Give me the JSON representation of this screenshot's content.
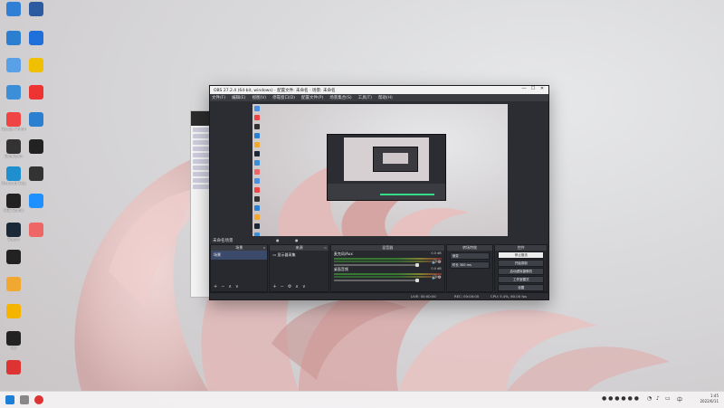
{
  "desktop": {
    "icons_left": [
      {
        "label": "",
        "icon": "monitor-icon",
        "color": "#2f7fd7"
      },
      {
        "label": "",
        "icon": "network-icon",
        "color": "#2b7fd0"
      },
      {
        "label": "",
        "icon": "control-panel-icon",
        "color": "#5aa0e6"
      },
      {
        "label": "",
        "icon": "computer-icon",
        "color": "#3a8fd8"
      },
      {
        "label": "Google Chrome",
        "icon": "chrome-icon",
        "color": "#e44"
      },
      {
        "label": "Bandicam",
        "icon": "camera-icon",
        "color": "#333"
      },
      {
        "label": "Microsoft Edge",
        "icon": "edge-icon",
        "color": "#1f8fd0"
      },
      {
        "label": "OBS Studio",
        "icon": "obs-icon",
        "color": "#222"
      },
      {
        "label": "Steam",
        "icon": "steam-icon",
        "color": "#1b2838"
      },
      {
        "label": "",
        "icon": "app-icon",
        "color": "#222"
      },
      {
        "label": "",
        "icon": "folder-icon",
        "color": "#f0a830"
      },
      {
        "label": "",
        "icon": "app-icon",
        "color": "#f5b400"
      },
      {
        "label": "QQ",
        "icon": "qq-icon",
        "color": "#222"
      },
      {
        "label": "",
        "icon": "music-icon",
        "color": "#d33"
      }
    ],
    "icons_right": [
      {
        "label": "",
        "icon": "app-icon",
        "color": "#2c5aa0"
      },
      {
        "label": "",
        "icon": "globe-icon",
        "color": "#1e6fd9"
      },
      {
        "label": "",
        "icon": "game-icon",
        "color": "#f0c000"
      },
      {
        "label": "",
        "icon": "app-icon",
        "color": "#e33"
      },
      {
        "label": "",
        "icon": "bird-icon",
        "color": "#2b7fd0"
      },
      {
        "label": "",
        "icon": "app-icon",
        "color": "#222"
      },
      {
        "label": "",
        "icon": "app-icon",
        "color": "#333"
      },
      {
        "label": "",
        "icon": "app-icon",
        "color": "#1e90ff"
      },
      {
        "label": "",
        "icon": "app-icon",
        "color": "#e66"
      }
    ]
  },
  "obs": {
    "title": "OBS 27.2.4 (64-bit, windows) - 配置文件: 未命名 - 场景: 未命名",
    "menu": [
      "文件(F)",
      "编辑(E)",
      "视图(V)",
      "停靠窗口(D)",
      "配置文件(P)",
      "场景集合(S)",
      "工具(T)",
      "帮助(H)"
    ],
    "scene_bar_label": "未命名场景",
    "toggle_a": "●",
    "toggle_b": "●",
    "docks": {
      "scenes": {
        "header": "场景",
        "items": [
          "场景"
        ]
      },
      "sources": {
        "header": "来源",
        "items": [
          "显示器采集"
        ]
      },
      "mixer": {
        "header": "混音器",
        "tracks": [
          {
            "name": "麦克风/Aux",
            "db": "0.0 dB"
          },
          {
            "name": "桌面音频",
            "db": "0.0 dB"
          }
        ]
      },
      "transitions": {
        "header": "转场特效",
        "type": "渐变",
        "duration_label": "时长",
        "duration": "300 ms"
      },
      "controls": {
        "header": "控件",
        "buttons": [
          "停止推流",
          "开始录制",
          "启动虚拟摄像机",
          "工作室模式",
          "设置",
          "退出"
        ]
      }
    },
    "status": {
      "live": "LIVE: 00:00:00",
      "rec": "REC: 00:00:00",
      "cpu": "CPU: 5.4%, 60.00 fps"
    }
  },
  "taskbar": {
    "clock_time": "1:45",
    "clock_date": "2022/6/11"
  }
}
